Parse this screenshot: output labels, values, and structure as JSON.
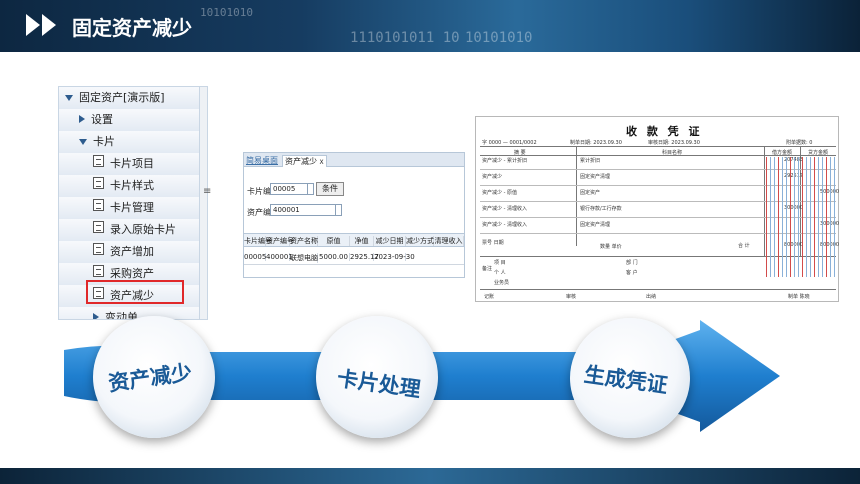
{
  "banner": {
    "title": "固定资产减少",
    "bits_top": "10101010",
    "bits_bottom_1": "1110101011 10",
    "bits_bottom_2": "10101010"
  },
  "tree": {
    "items": [
      {
        "label": "固定资产[演示版]",
        "kind": "expanded",
        "icon": "expand-triangle-icon"
      },
      {
        "label": "设置",
        "kind": "collapsed",
        "icon": "collapse-triangle-icon"
      },
      {
        "label": "卡片",
        "kind": "expanded",
        "icon": "expand-triangle-icon"
      },
      {
        "label": "卡片项目",
        "kind": "leaf",
        "icon": "document-icon"
      },
      {
        "label": "卡片样式",
        "kind": "leaf",
        "icon": "document-icon"
      },
      {
        "label": "卡片管理",
        "kind": "leaf",
        "icon": "document-icon"
      },
      {
        "label": "录入原始卡片",
        "kind": "leaf",
        "icon": "document-icon"
      },
      {
        "label": "资产增加",
        "kind": "leaf",
        "icon": "document-icon"
      },
      {
        "label": "采购资产",
        "kind": "leaf",
        "icon": "document-icon"
      },
      {
        "label": "资产减少",
        "kind": "leaf",
        "icon": "document-icon",
        "highlighted": true
      },
      {
        "label": "变动单",
        "kind": "collapsed",
        "icon": "collapse-triangle-icon"
      }
    ],
    "highlight_color": "#e0282a"
  },
  "form": {
    "tabs": [
      "简易桌面",
      "资产减少"
    ],
    "close_mark": "X",
    "card_no_label": "卡片编号",
    "card_no_value": "00005",
    "asset_no_label": "资产编号",
    "asset_no_value": "400001",
    "add_button": "条件",
    "columns": [
      "卡片编号",
      "资产编号",
      "资产名称",
      "原值",
      "净值",
      "减少日期",
      "减少方式",
      "清理收入"
    ],
    "row": [
      "00005",
      "400001",
      "联想电脑",
      "5000.00",
      "2925.17",
      "2023-09-30",
      "",
      ""
    ]
  },
  "voucher": {
    "title": "收 款 凭 证",
    "header_left": "字 0000 — 0001/0002",
    "header_date": "制单日期: 2023.09.30",
    "header_audit": "审核日期: 2023.09.30",
    "header_attach": "附单据数: 0",
    "col_summary": "摘 要",
    "col_subject": "科目名称",
    "col_debit": "借方金额",
    "col_credit": "贷方金额",
    "rows": [
      {
        "summary": "资产减少 - 累计折旧",
        "subject": "累计折旧",
        "debit": "207483",
        "credit": ""
      },
      {
        "summary": "资产减少",
        "subject": "固定资产清理",
        "debit": "292517",
        "credit": ""
      },
      {
        "summary": "资产减少 - 原值",
        "subject": "固定资产",
        "debit": "",
        "credit": "500000"
      },
      {
        "summary": "资产减少 - 清理收入",
        "subject": "银行存款/工行存款",
        "debit": "300000",
        "credit": ""
      },
      {
        "summary": "资产减少 - 清理收入",
        "subject": "固定资产清理",
        "debit": "",
        "credit": "300000"
      }
    ],
    "note_label": "票号 日期",
    "qty_label": "数量 单价",
    "total_label": "合 计",
    "total_debit": "800000",
    "total_credit": "800000",
    "remark_label": "备注",
    "project_label": "项 目",
    "dept_label": "部 门",
    "person_label": "个 人",
    "customer_label": "客 户",
    "salesman_label": "业务员",
    "footer": [
      "记账",
      "审核",
      "出纳",
      "制单 陈晓"
    ]
  },
  "flow": {
    "steps": [
      "资产减少",
      "卡片处理",
      "生成凭证"
    ],
    "arrow_color": "#1f7fcf"
  }
}
